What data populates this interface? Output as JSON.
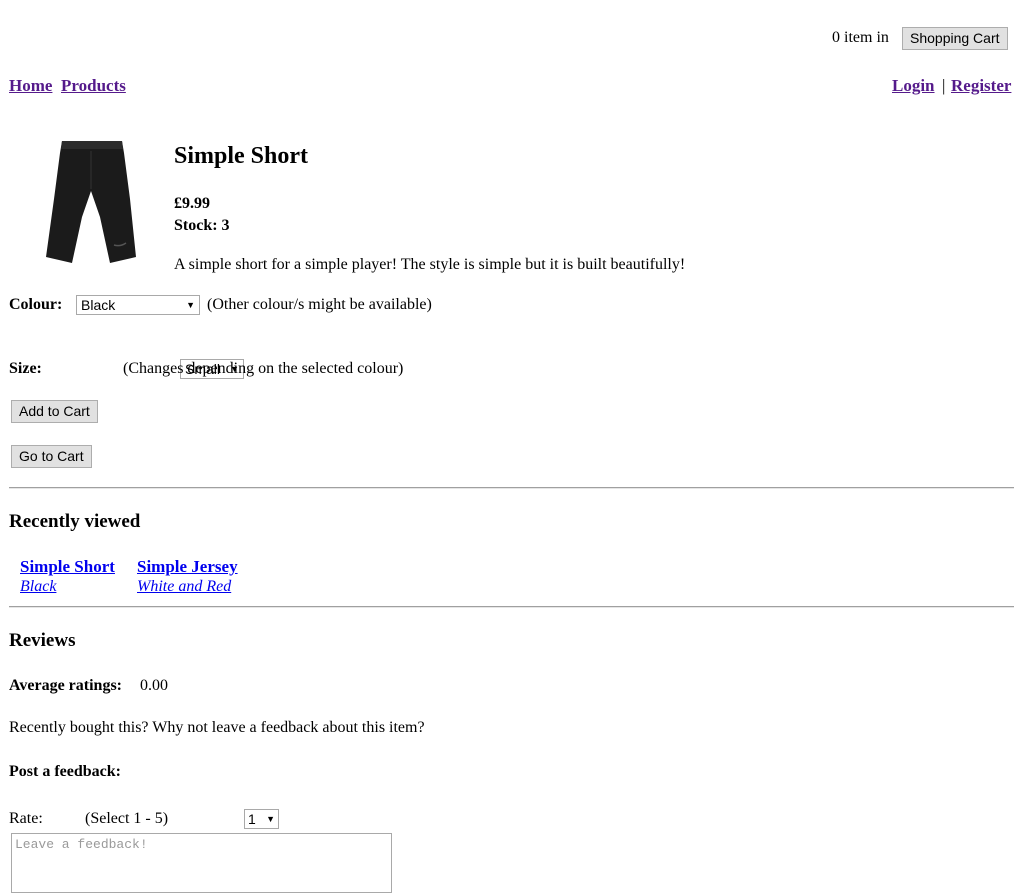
{
  "header": {
    "cart_count_text": "0 item in",
    "cart_button": "Shopping Cart"
  },
  "nav": {
    "home": "Home",
    "products": "Products",
    "login": "Login",
    "separator": "|",
    "register": "Register"
  },
  "product": {
    "image_icon": "shorts-icon",
    "title": "Simple Short",
    "price": "£9.99",
    "stock": "Stock: 3",
    "description": "A simple short for a simple player! The style is simple but it is built beautifully!",
    "colour_label": "Colour:",
    "colour_value": "Black",
    "colour_note": "(Other colour/s might be available)",
    "size_label": "Size:",
    "size_value": "Small",
    "size_note": "(Changes depending on the selected colour)",
    "add_to_cart": "Add to Cart",
    "go_to_cart": "Go to Cart"
  },
  "recently_viewed": {
    "heading": "Recently viewed",
    "items": [
      {
        "name": "Simple Short",
        "variant": "Black"
      },
      {
        "name": "Simple Jersey",
        "variant": "White and Red"
      }
    ]
  },
  "reviews": {
    "heading": "Reviews",
    "avg_label": "Average ratings:",
    "avg_value": "0.00",
    "prompt": "Recently bought this? Why not leave a feedback about this item?",
    "post_heading": "Post a feedback:",
    "rate_label": "Rate:",
    "rate_value": "1",
    "rate_note": "(Select 1 - 5)",
    "feedback_placeholder": "Leave a feedback!"
  },
  "colors": {
    "visited_link": "#551a8b",
    "link": "#0000ee",
    "button_bg": "#e1e1e1"
  }
}
